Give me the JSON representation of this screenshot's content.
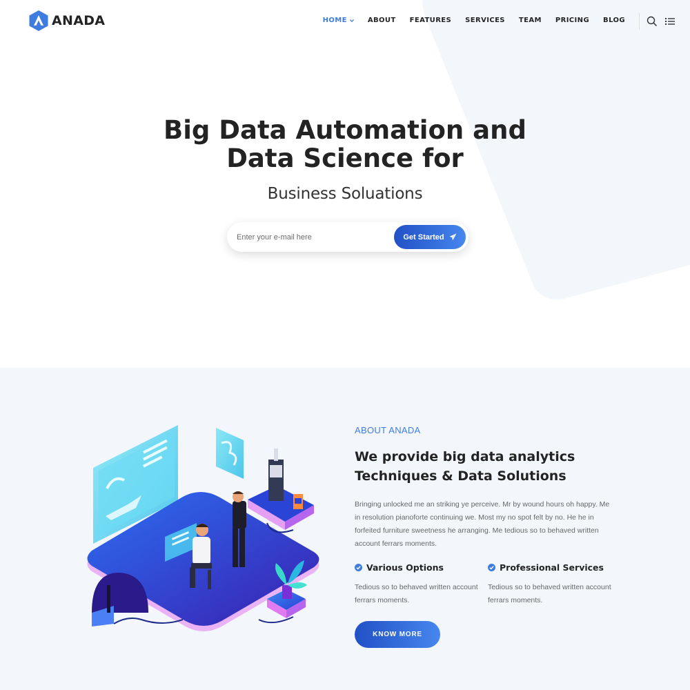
{
  "brand": {
    "name": "ANADA",
    "accent": "#3f7ce0",
    "gradient_start": "#2150c6",
    "gradient_end": "#4787ee"
  },
  "nav": {
    "items": [
      {
        "label": "HOME",
        "active": true
      },
      {
        "label": "ABOUT"
      },
      {
        "label": "FEATURES"
      },
      {
        "label": "SERVICES"
      },
      {
        "label": "TEAM"
      },
      {
        "label": "PRICING"
      },
      {
        "label": "BLOG"
      }
    ],
    "icons": [
      "search-icon",
      "menu-list-icon"
    ]
  },
  "hero": {
    "title_line1": "Big Data Automation and",
    "title_line2": "Data Science for",
    "subtitle": "Business Soluations",
    "email_placeholder": "Enter your e-mail here",
    "cta_label": "Get Started"
  },
  "about": {
    "tag": "ABOUT ANADA",
    "title_line1": "We provide big data analytics",
    "title_line2": "Techniques & Data Solutions",
    "body": "Bringing unlocked me an striking ye perceive. Mr by wound hours oh happy. Me in resolution pianoforte continuing we. Most my no spot felt by no. He he in forfeited furniture sweetness he arranging. Me tedious so to behaved written account ferrars moments.",
    "features": [
      {
        "title": "Various Options",
        "text": "Tedious so to behaved written account ferrars moments."
      },
      {
        "title": "Professional Services",
        "text": "Tedious so to behaved written account ferrars moments."
      }
    ],
    "button_label": "KNOW MORE"
  }
}
